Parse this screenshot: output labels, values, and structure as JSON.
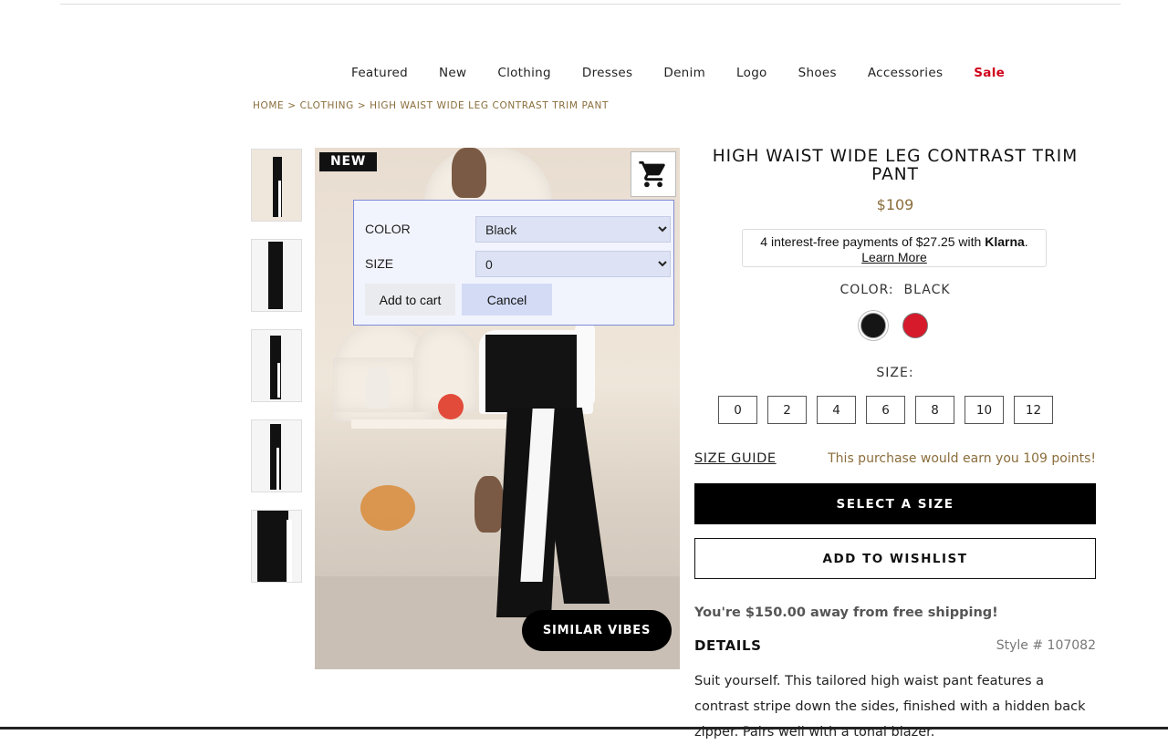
{
  "nav": {
    "items": [
      "Featured",
      "New",
      "Clothing",
      "Dresses",
      "Denim",
      "Logo",
      "Shoes",
      "Accessories",
      "Sale"
    ]
  },
  "breadcrumb": {
    "home": "HOME",
    "sep": ">",
    "category": "CLOTHING",
    "current": "HIGH WAIST WIDE LEG CONTRAST TRIM PANT"
  },
  "gallery": {
    "badge": "NEW",
    "similar_label": "SIMILAR VIBES",
    "cart_icon": "shopping-cart-icon"
  },
  "popup": {
    "color_label": "COLOR",
    "color_value": "Black",
    "size_label": "SIZE",
    "size_value": "0",
    "add_label": "Add to cart",
    "cancel_label": "Cancel"
  },
  "product": {
    "title": "HIGH WAIST WIDE LEG CONTRAST TRIM PANT",
    "price": "$109",
    "klarna_text": "4 interest-free payments of $27.25 with",
    "klarna_brand": "Klarna",
    "klarna_link": "Learn More",
    "color_label": "COLOR:",
    "color_value": "BLACK",
    "swatches": [
      {
        "name": "Black",
        "hex": "#151515"
      },
      {
        "name": "Red",
        "hex": "#d7192c"
      }
    ],
    "size_label": "SIZE:",
    "sizes": [
      "0",
      "2",
      "4",
      "6",
      "8",
      "10",
      "12"
    ],
    "size_guide": "SIZE GUIDE",
    "points": "This purchase would earn you 109 points!",
    "select_size_btn": "SELECT A SIZE",
    "wishlist_btn": "ADD TO WISHLIST",
    "shipping": "You're $150.00 away from free shipping!",
    "details_heading": "DETAILS",
    "style_number": "Style # 107082",
    "description": "Suit yourself. This tailored high waist pant features a contrast stripe down the sides, finished with a hidden back zipper. Pairs well with a tonal blazer."
  },
  "colors": {
    "accent_gold": "#8a6d3b",
    "sale_red": "#d0021b"
  }
}
